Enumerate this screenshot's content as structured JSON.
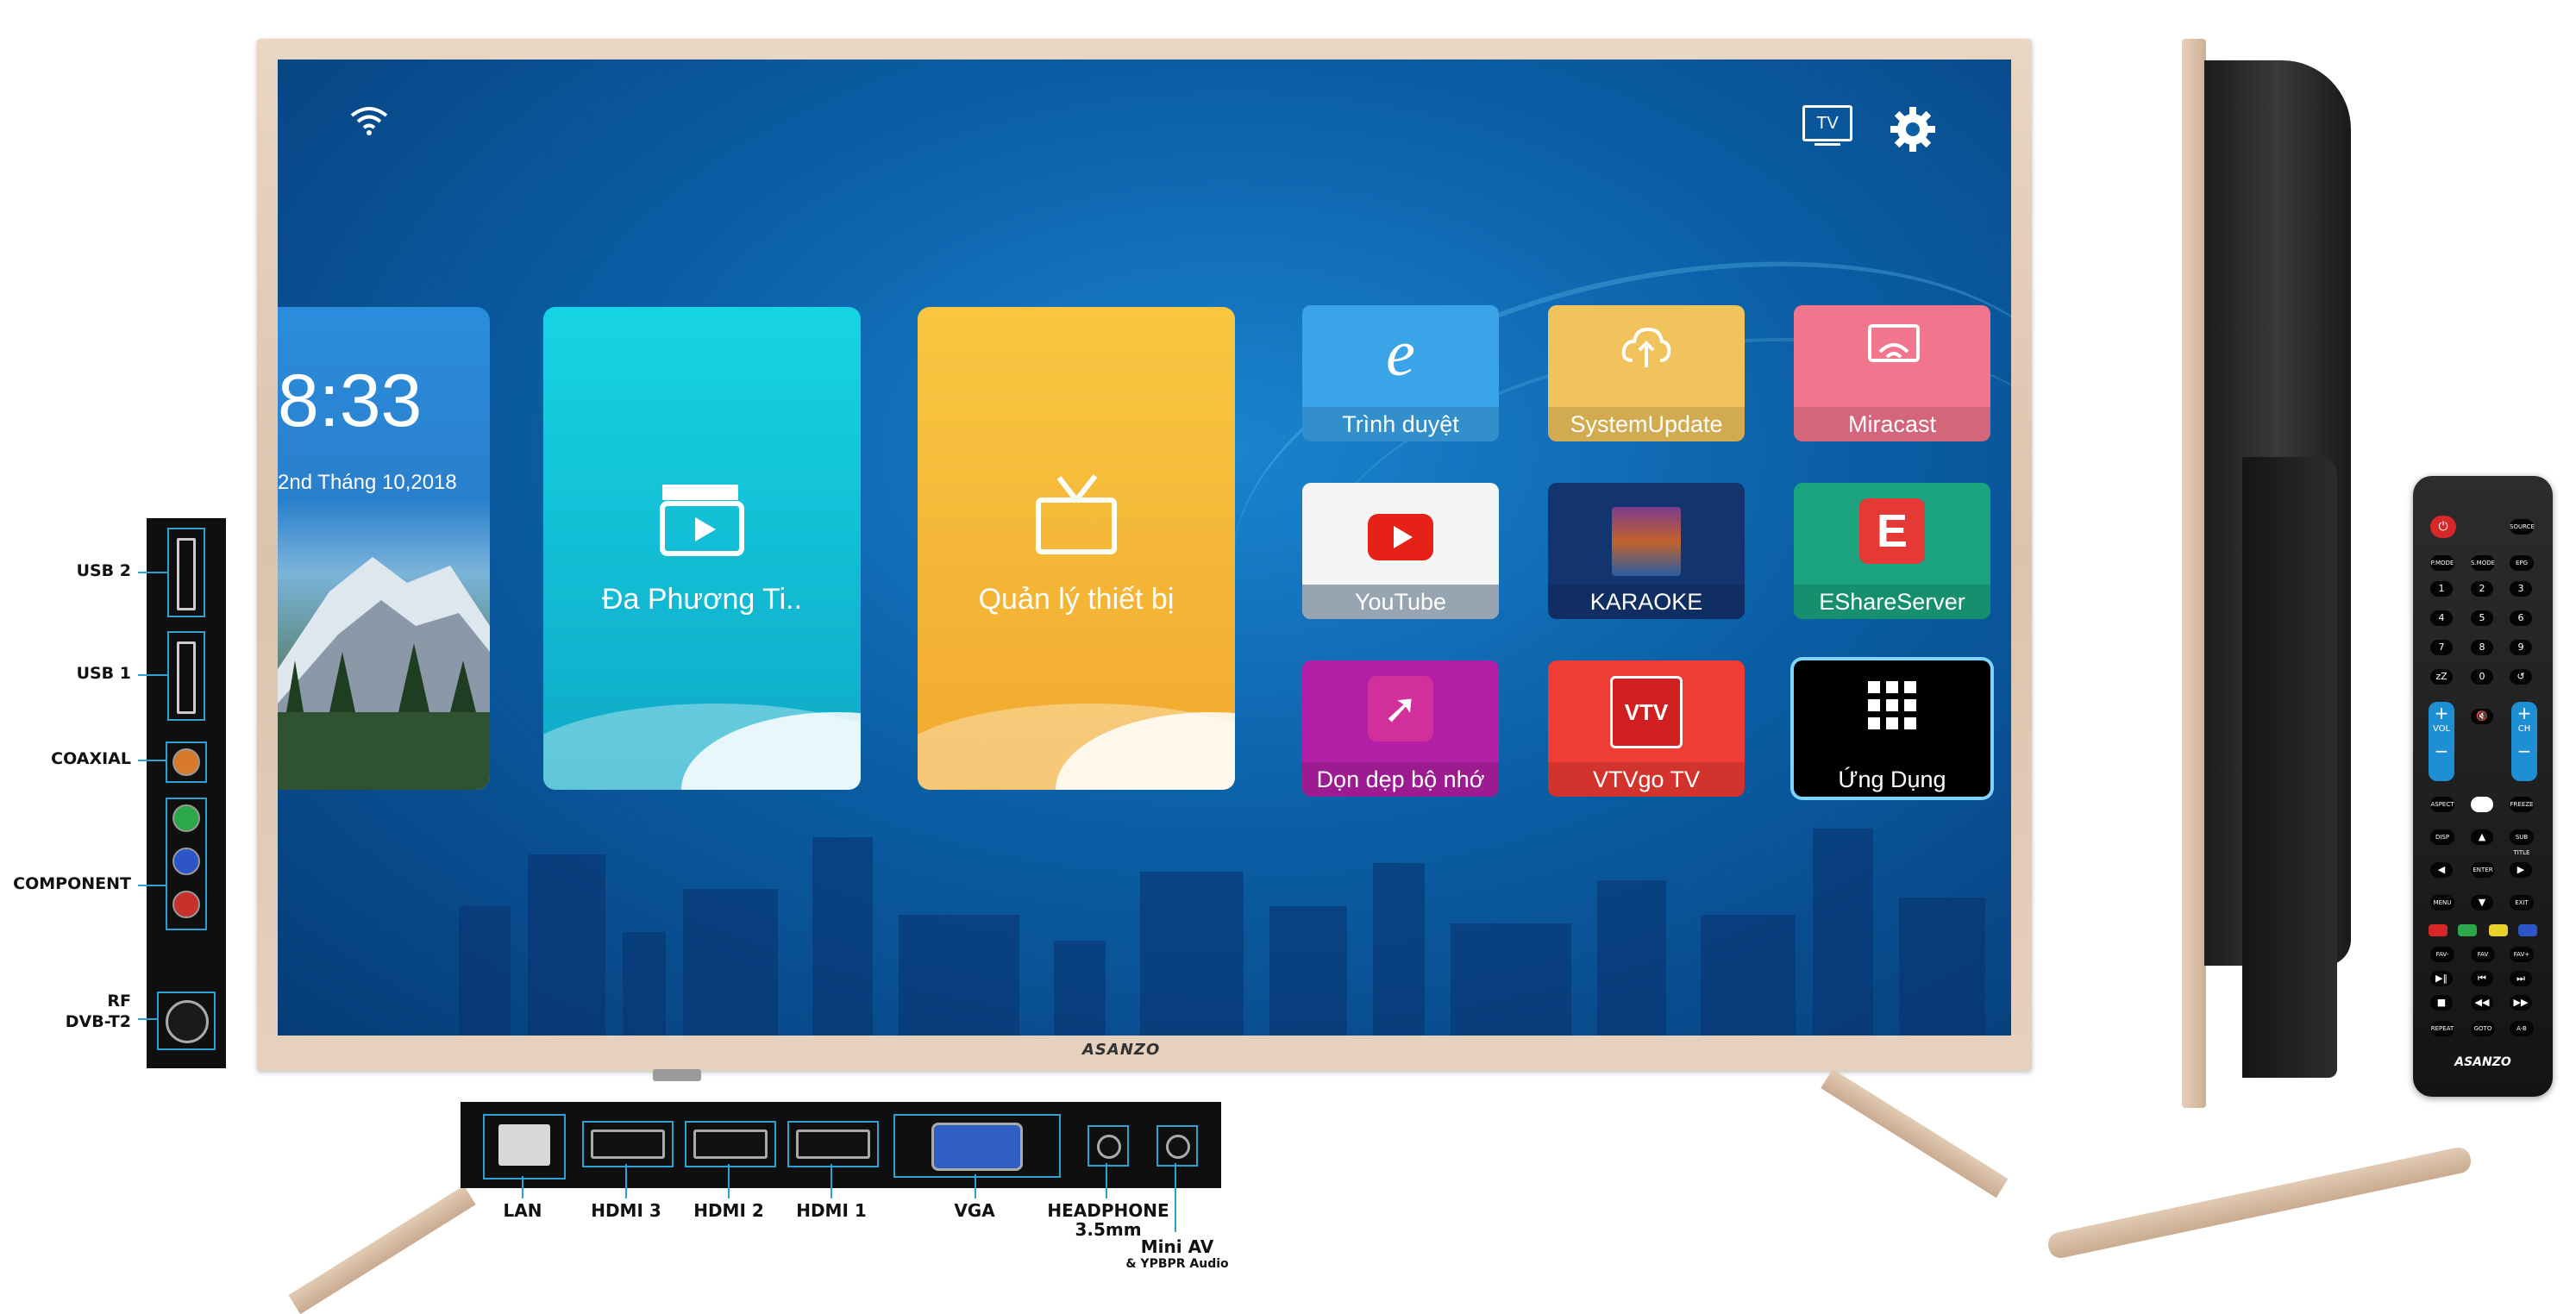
{
  "screen": {
    "clock": {
      "time": "8:33",
      "date": "2nd Tháng 10,2018"
    },
    "big_tiles": [
      {
        "label": "Đa Phương Ti..",
        "icon": "clapperboard-icon"
      },
      {
        "label": "Quản lý thiết bị",
        "icon": "tv-icon"
      }
    ],
    "apps": [
      {
        "label": "Trình duyệt",
        "icon": "browser-icon"
      },
      {
        "label": "SystemUpdate",
        "icon": "cloud-upload-icon"
      },
      {
        "label": "Miracast",
        "icon": "cast-icon"
      },
      {
        "label": "YouTube",
        "icon": "youtube-icon"
      },
      {
        "label": "KARAOKE",
        "icon": "karaoke-icon"
      },
      {
        "label": "EShareServer",
        "icon": "eshare-icon"
      },
      {
        "label": "Dọn dẹp bộ nhớ",
        "icon": "rocket-icon"
      },
      {
        "label": "VTVgo TV",
        "icon": "vtvgo-icon"
      },
      {
        "label": "Ứng Dụng",
        "icon": "grid-icon"
      }
    ],
    "input_icon_label": "TV",
    "colors": {
      "browser": "#3ba3e8",
      "update": "#f0c35c",
      "miracast": "#f1758d",
      "youtube": "#f5f5f5",
      "karaoke": "#13356f",
      "eshare": "#1aa37e",
      "cleaner": "#b21fa6",
      "vtvgo": "#ef3c34",
      "apps": "#000000"
    }
  },
  "brand": "ASANZO",
  "side_ports": [
    "USB 2",
    "USB 1",
    "COAXIAL",
    "COMPONENT",
    "RF",
    "DVB-T2"
  ],
  "bottom_ports": [
    "LAN",
    "HDMI 3",
    "HDMI 2",
    "HDMI 1",
    "VGA",
    "HEADPHONE",
    "3.5mm",
    "Mini AV",
    "& YPBPR Audio"
  ],
  "remote": {
    "top_row": [
      "⏻",
      "SOURCE"
    ],
    "row2": [
      "P.MODE",
      "S.MODE",
      "EPG"
    ],
    "digits": [
      "1",
      "2",
      "3",
      "4",
      "5",
      "6",
      "7",
      "8",
      "9",
      "zZ",
      "0",
      "↺"
    ],
    "vol": "VOL",
    "ch": "CH",
    "mid_rows": [
      [
        "ASPECT",
        "FREEZE"
      ],
      [
        "DISP",
        "SUB TITLE"
      ]
    ],
    "nav": [
      "▲",
      "◀",
      "ENTER",
      "▶",
      "▼"
    ],
    "menu": "MENU",
    "exit": "EXIT",
    "row_fav": [
      "FAV-",
      "FAV",
      "FAV+"
    ],
    "row_media1": [
      "▶‖",
      "⏮",
      "⏭"
    ],
    "row_media2": [
      "■",
      "◀◀",
      "▶▶"
    ],
    "row_last": [
      "REPEAT",
      "GOTO",
      "A-B"
    ],
    "logo": "ASANZO"
  }
}
